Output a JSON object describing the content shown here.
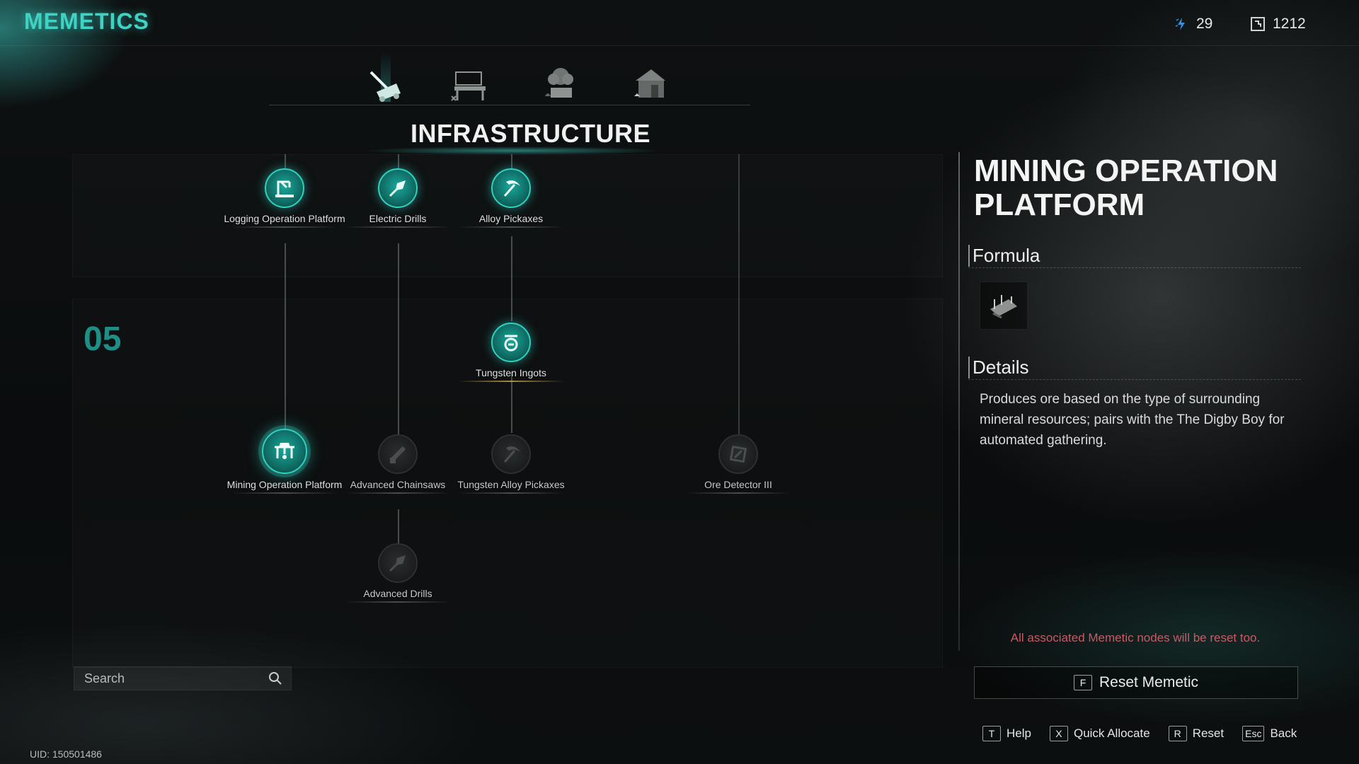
{
  "app": {
    "title": "MEMETICS"
  },
  "currencies": [
    {
      "icon": "memetic-points-icon",
      "value": "29"
    },
    {
      "icon": "data-chip-icon",
      "value": "1212"
    }
  ],
  "tabs": [
    {
      "icon": "drill-machine-icon",
      "active": true
    },
    {
      "icon": "workbench-icon",
      "active": false
    },
    {
      "icon": "planter-icon",
      "active": false
    },
    {
      "icon": "house-icon",
      "active": false
    }
  ],
  "section": {
    "title": "INFRASTRUCTURE",
    "tier": "05"
  },
  "nodes": {
    "logging_platform": {
      "label": "Logging Operation Platform",
      "state": "unlocked",
      "icon": "crane-icon"
    },
    "electric_drills": {
      "label": "Electric Drills",
      "state": "unlocked",
      "icon": "drill-icon"
    },
    "alloy_pickaxes": {
      "label": "Alloy Pickaxes",
      "state": "unlocked",
      "icon": "pickaxe-icon"
    },
    "tungsten_ingots": {
      "label": "Tungsten Ingots",
      "state": "unlocked",
      "icon": "ingot-icon"
    },
    "mining_platform": {
      "label": "Mining Operation Platform",
      "state": "selected",
      "icon": "mining-rig-icon"
    },
    "advanced_chainsaws": {
      "label": "Advanced Chainsaws",
      "state": "locked",
      "icon": "chainsaw-icon"
    },
    "tungsten_alloy_pickaxes": {
      "label": "Tungsten Alloy Pickaxes",
      "state": "locked",
      "icon": "pickaxe-icon"
    },
    "ore_detector": {
      "label": "Ore Detector III",
      "state": "locked",
      "icon": "detector-icon"
    },
    "advanced_drills": {
      "label": "Advanced Drills",
      "state": "locked",
      "icon": "drill-icon"
    }
  },
  "search": {
    "placeholder": "Search"
  },
  "uid": "UID: 150501486",
  "detail": {
    "title": "MINING OPERATION PLATFORM",
    "formula_label": "Formula",
    "formula_icon": "mining-platform-blueprint-icon",
    "details_label": "Details",
    "description": "Produces ore based on the type of surrounding mineral resources; pairs with the The Digby Boy for automated gathering.",
    "warning": "All associated Memetic nodes will be reset too.",
    "reset_key": "F",
    "reset_label": "Reset Memetic"
  },
  "hints": [
    {
      "key": "T",
      "label": "Help"
    },
    {
      "key": "X",
      "label": "Quick Allocate"
    },
    {
      "key": "R",
      "label": "Reset"
    },
    {
      "key": "Esc",
      "label": "Back"
    }
  ],
  "colors": {
    "accent": "#3fd3c3",
    "warning": "#c95a63",
    "locked": "#2b2e2f"
  }
}
